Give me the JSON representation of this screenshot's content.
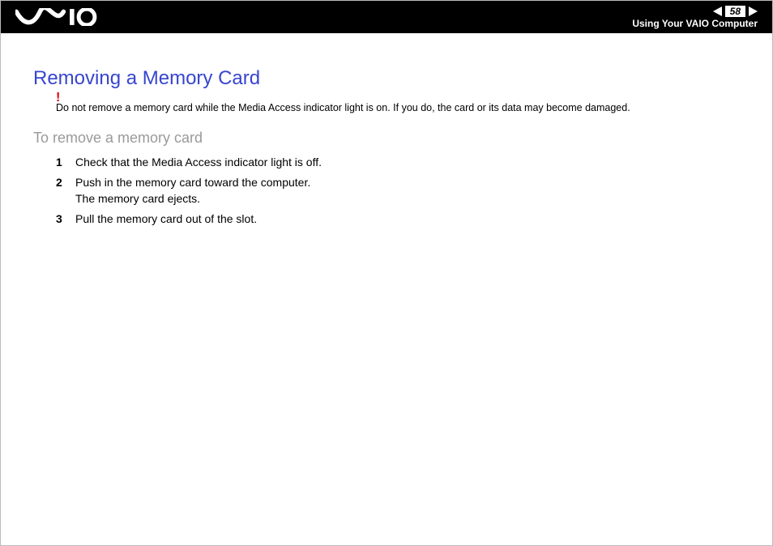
{
  "header": {
    "page_number": "58",
    "section_link": "Using Your VAIO Computer"
  },
  "content": {
    "title": "Removing a Memory Card",
    "warning_mark": "!",
    "warning_text": "Do not remove a memory card while the Media Access indicator light is on. If you do, the card or its data may become damaged.",
    "subheading": "To remove a memory card",
    "steps": [
      {
        "text": "Check that the Media Access indicator light is off."
      },
      {
        "text": "Push in the memory card toward the computer.",
        "sub": "The memory card ejects."
      },
      {
        "text": "Pull the memory card out of the slot."
      }
    ]
  }
}
